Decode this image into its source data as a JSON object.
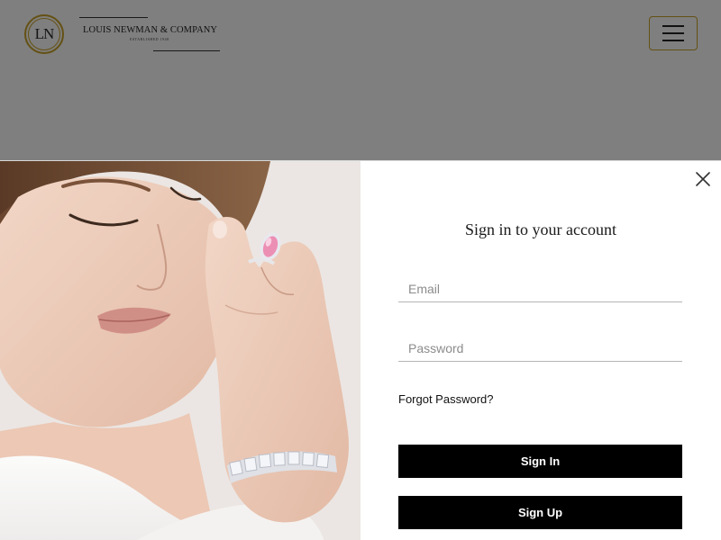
{
  "header": {
    "logo_monogram": "LN",
    "logo_name": "LOUIS NEWMAN & COMPANY",
    "logo_tagline": "ESTABLISHED 1948",
    "menu_icon": "hamburger-menu-icon",
    "accent_color": "#c9a227"
  },
  "modal": {
    "title": "Sign in to your account",
    "close_icon": "close-icon",
    "email": {
      "placeholder": "Email",
      "value": ""
    },
    "password": {
      "placeholder": "Password",
      "value": ""
    },
    "forgot_label": "Forgot Password?",
    "signin_label": "Sign In",
    "signup_label": "Sign Up",
    "button_color": "#000000"
  }
}
